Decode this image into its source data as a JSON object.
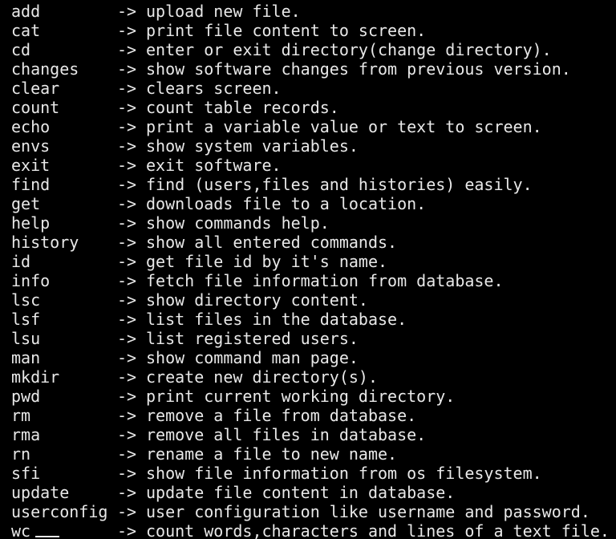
{
  "terminal": {
    "arrow": "->",
    "commands": [
      {
        "name": "add",
        "description": "upload new file."
      },
      {
        "name": "cat",
        "description": "print file content to screen."
      },
      {
        "name": "cd",
        "description": "enter or exit directory(change directory)."
      },
      {
        "name": "changes",
        "description": "show software changes from previous version."
      },
      {
        "name": "clear",
        "description": "clears screen."
      },
      {
        "name": "count",
        "description": "count table records."
      },
      {
        "name": "echo",
        "description": "print a variable value or text to screen."
      },
      {
        "name": "envs",
        "description": "show system variables."
      },
      {
        "name": "exit",
        "description": "exit software."
      },
      {
        "name": "find",
        "description": "find (users,files and histories) easily."
      },
      {
        "name": "get",
        "description": "downloads file to a location."
      },
      {
        "name": "help",
        "description": "show commands help."
      },
      {
        "name": "history",
        "description": "show all entered commands."
      },
      {
        "name": "id",
        "description": "get file id by it's name."
      },
      {
        "name": "info",
        "description": "fetch file information from database."
      },
      {
        "name": "lsc",
        "description": "show directory content."
      },
      {
        "name": "lsf",
        "description": "list files in the database."
      },
      {
        "name": "lsu",
        "description": "list registered users."
      },
      {
        "name": "man",
        "description": "show command man page."
      },
      {
        "name": "mkdir",
        "description": "create new directory(s)."
      },
      {
        "name": "pwd",
        "description": "print current working directory."
      },
      {
        "name": "rm",
        "description": "remove a file from database."
      },
      {
        "name": "rma",
        "description": "remove all files in database."
      },
      {
        "name": "rn",
        "description": "rename a file to new name."
      },
      {
        "name": "sfi",
        "description": "show file information from os filesystem."
      },
      {
        "name": "update",
        "description": "update file content in database."
      },
      {
        "name": "userconfig",
        "description": "user configuration like username and password."
      },
      {
        "name": "wc",
        "description": "count words,characters and lines of a text file."
      }
    ]
  },
  "colors": {
    "background": "#000000",
    "text": "#e8e8e8"
  }
}
